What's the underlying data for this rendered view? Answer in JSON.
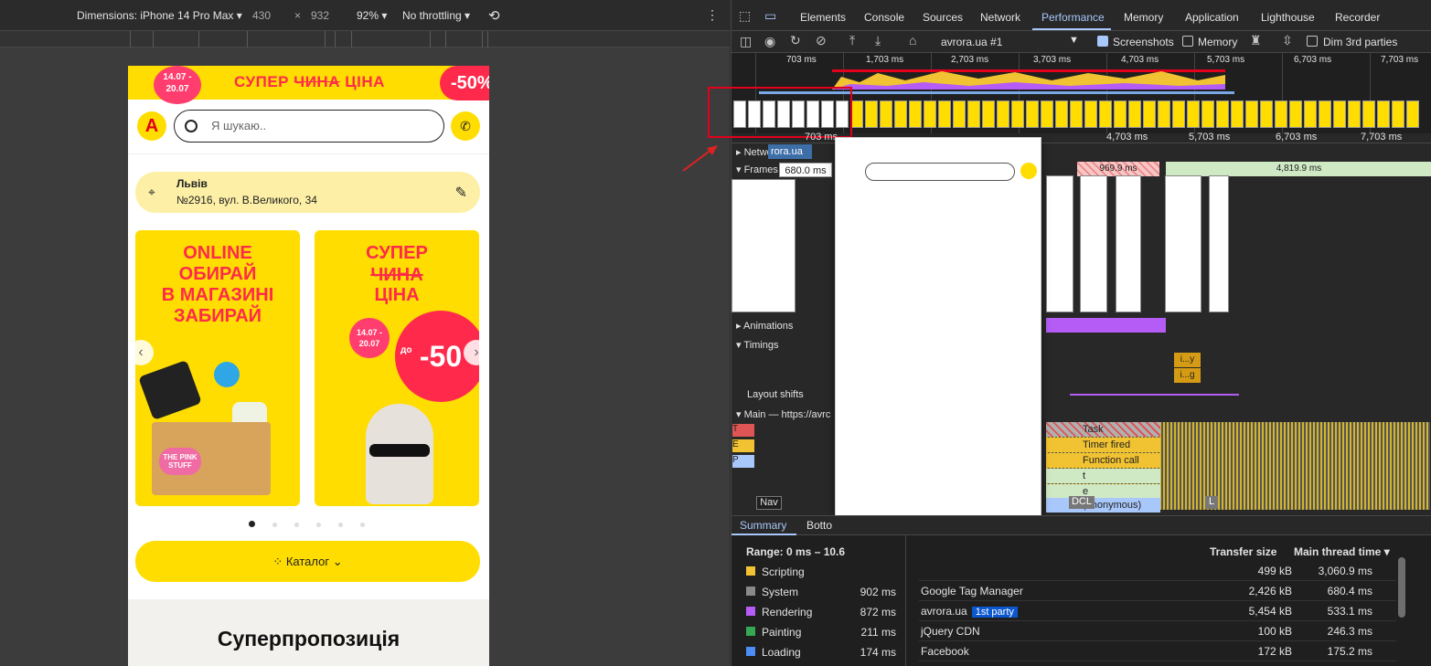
{
  "device_toolbar": {
    "dimensions_label": "Dimensions: iPhone 14 Pro Max",
    "width": "430",
    "times": "×",
    "height": "932",
    "zoom": "92%",
    "throttling": "No throttling"
  },
  "phone": {
    "promo_date": "14.07 - 20.07",
    "promo_title_a": "СУПЕР ",
    "promo_title_strike": "ЧИНА",
    "promo_title_b": " ЦІНА",
    "promo_badge": "-50%",
    "logo": "A",
    "search_placeholder": "Я шукаю..",
    "city": "Львів",
    "street": "№2916, вул. В.Великого, 34",
    "banner1_text": [
      "ONLINE",
      "ОБИРАЙ",
      "В МАГАЗИНІ",
      "ЗАБИРАЙ"
    ],
    "banner1_product": "THE PINK STUFF",
    "banner2_text_a": "СУПЕР",
    "banner2_strike": "ЧИНА",
    "banner2_text_b": "ЦІНА",
    "banner2_date": "14.07 - 20.07",
    "banner2_discount": "-50",
    "banner2_prefix": "до",
    "catalog_label": "Каталог",
    "section_title": "Суперпропозиція"
  },
  "devtools": {
    "tabs": [
      "Elements",
      "Console",
      "Sources",
      "Network",
      "Performance",
      "Memory",
      "Application",
      "Lighthouse",
      "Recorder"
    ],
    "active_tab": "Performance",
    "recording_target": "avrora.ua #1",
    "screenshots_label": "Screenshots",
    "memory_label": "Memory",
    "dim_label": "Dim 3rd parties",
    "overview_ticks": [
      "703 ms",
      "1,703 ms",
      "2,703 ms",
      "3,703 ms",
      "4,703 ms",
      "5,703 ms",
      "6,703 ms",
      "7,703 ms"
    ],
    "timeline_ticks": [
      "703 ms",
      "4,703 ms",
      "5,703 ms",
      "6,703 ms",
      "7,703 ms"
    ],
    "tracks": {
      "network": "Network",
      "network_tip": "rora.ua",
      "frames": "Frames",
      "frame_tooltip": "680.0 ms",
      "frame_bar_a": "969.9 ms",
      "frame_bar_b": "4,819.9 ms",
      "animations": "Animations",
      "timings": "Timings",
      "timing_a": "i...y",
      "timing_b": "i...g",
      "layout_shifts": "Layout shifts",
      "main": "Main — https://avrc",
      "nav": "Nav",
      "dcl": "DCL",
      "l": "L"
    },
    "flame": [
      "Task",
      "Timer fired",
      "Function call",
      "t",
      "e",
      "(anonymous)"
    ],
    "bottom_tabs": [
      "Summary",
      "Botto"
    ],
    "summary": {
      "range": "Range: 0 ms – 10.6",
      "categories": [
        {
          "name": "Scripting",
          "ms": "",
          "color": "#f1c232"
        },
        {
          "name": "System",
          "ms": "902 ms",
          "color": "#8a8a8a"
        },
        {
          "name": "Rendering",
          "ms": "872 ms",
          "color": "#b45cf5"
        },
        {
          "name": "Painting",
          "ms": "211 ms",
          "color": "#34a853"
        },
        {
          "name": "Loading",
          "ms": "174 ms",
          "color": "#4c8df6"
        }
      ]
    },
    "third_party": {
      "col_transfer": "Transfer size",
      "col_main": "Main thread time",
      "rows": [
        {
          "name": "",
          "badge": "",
          "size": "499 kB",
          "time": "3,060.9 ms"
        },
        {
          "name": "Google Tag Manager",
          "badge": "",
          "size": "2,426 kB",
          "time": "680.4 ms"
        },
        {
          "name": "avrora.ua",
          "badge": "1st party",
          "size": "5,454 kB",
          "time": "533.1 ms"
        },
        {
          "name": "jQuery CDN",
          "badge": "",
          "size": "100 kB",
          "time": "246.3 ms"
        },
        {
          "name": "Facebook",
          "badge": "",
          "size": "172 kB",
          "time": "175.2 ms"
        }
      ]
    }
  }
}
